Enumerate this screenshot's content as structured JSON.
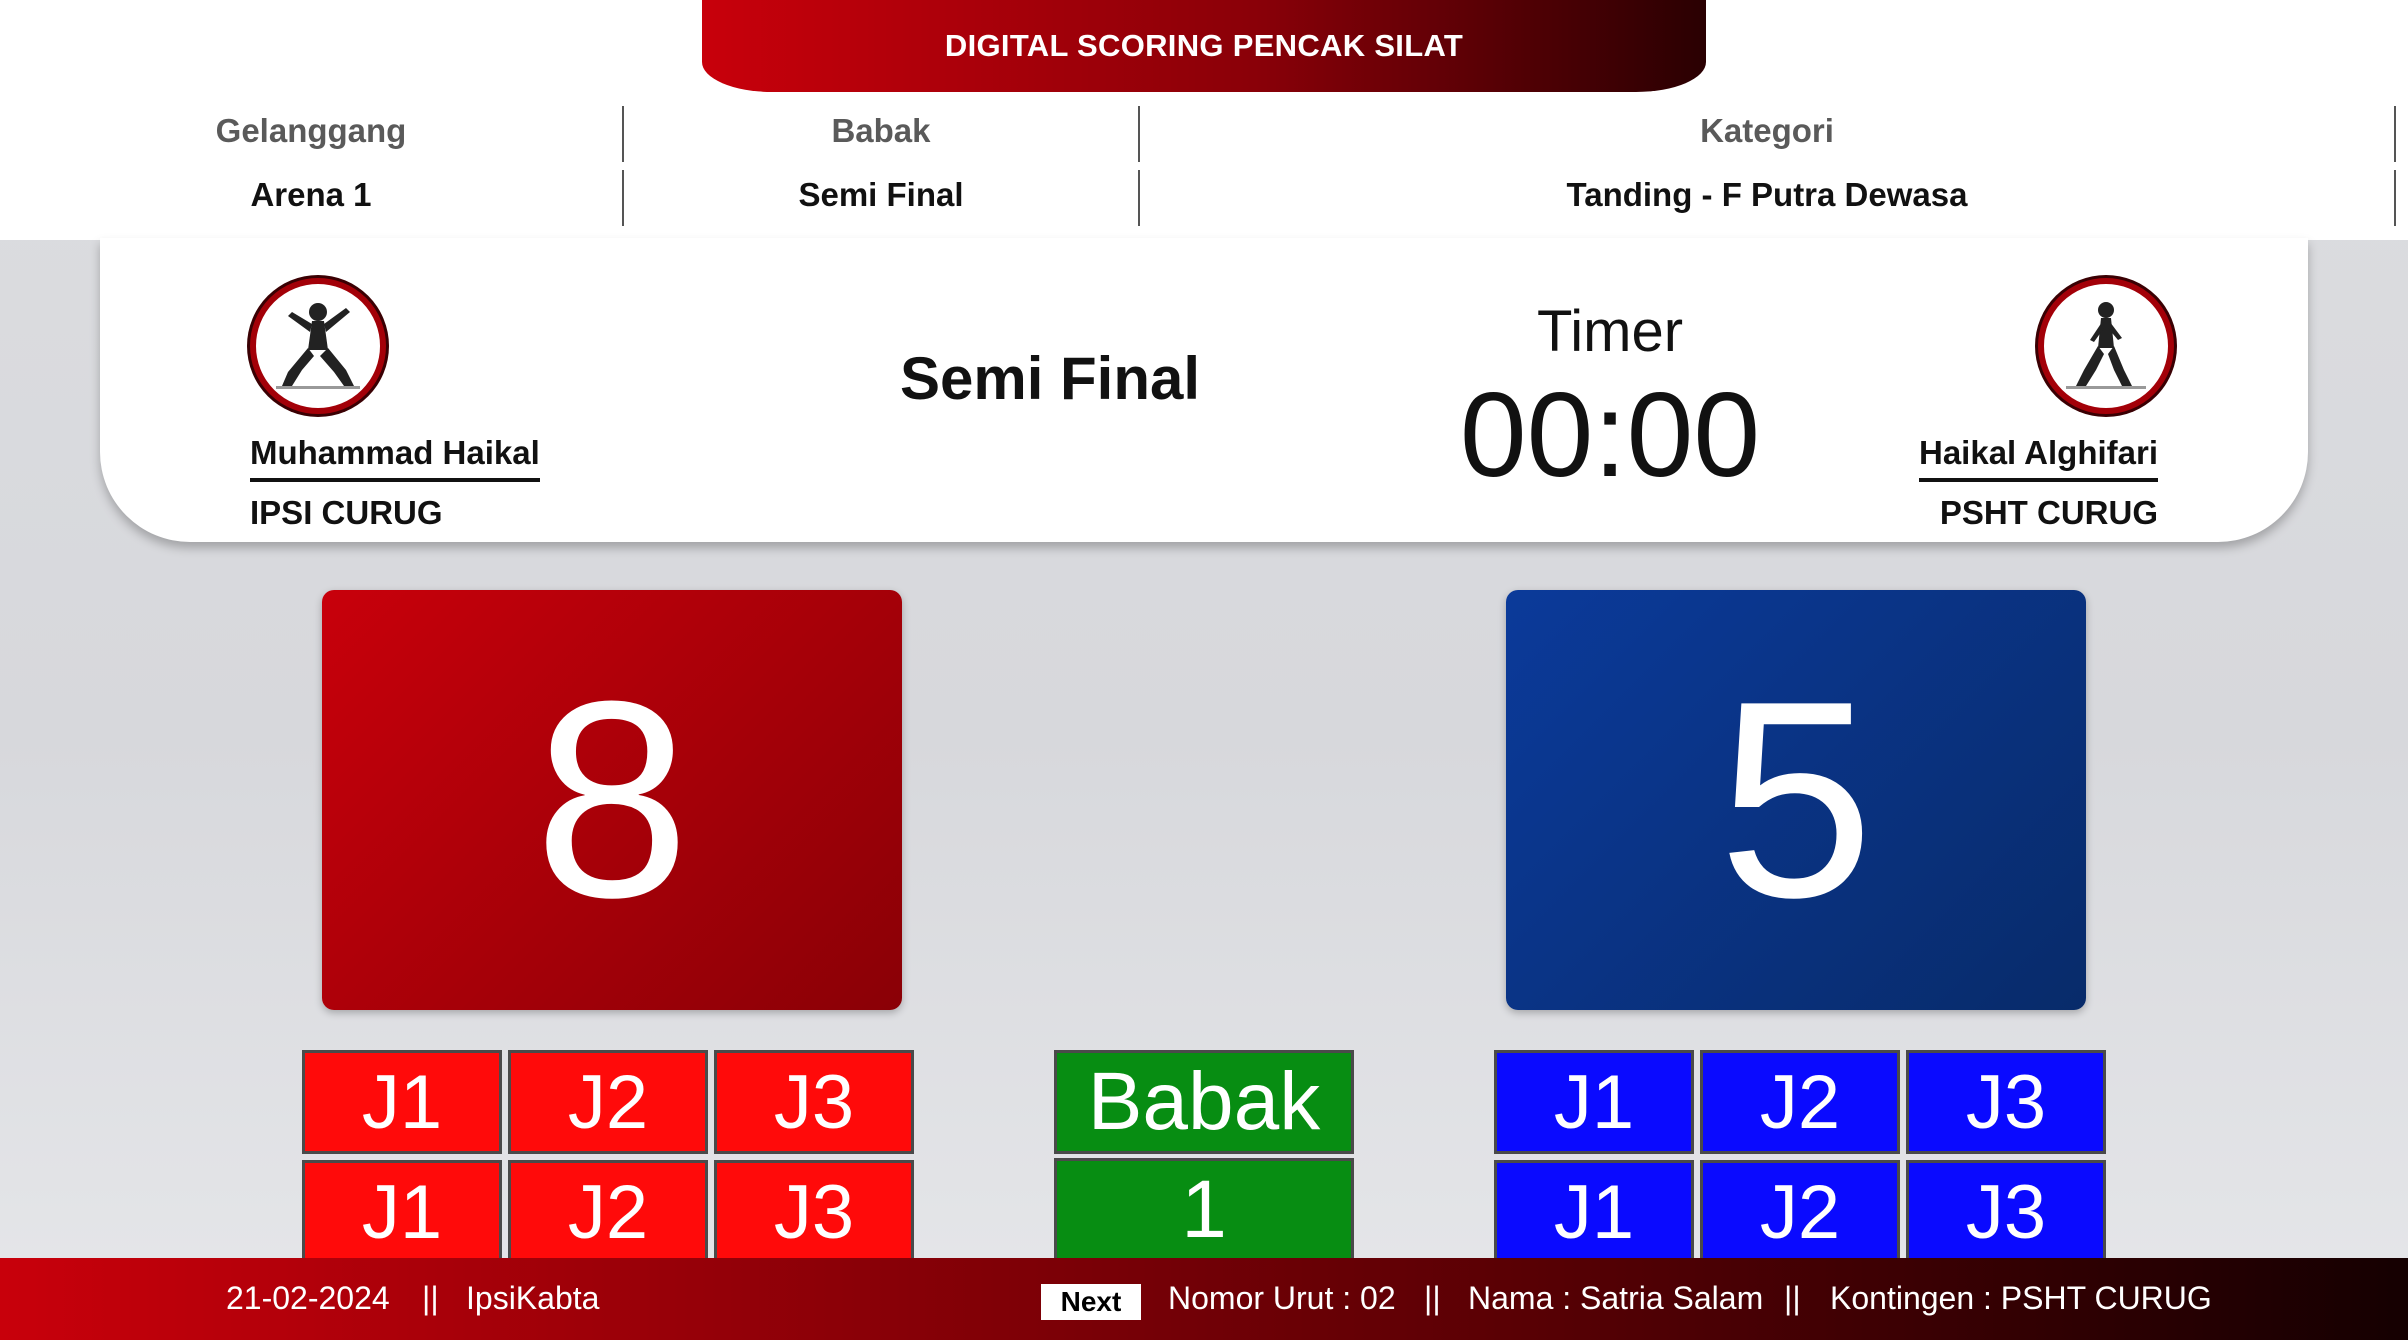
{
  "header": {
    "title": "DIGITAL SCORING PENCAK SILAT"
  },
  "info": {
    "gelanggang_label": "Gelanggang",
    "gelanggang_value": "Arena 1",
    "babak_label": "Babak",
    "babak_value": "Semi Final",
    "kategori_label": "Kategori",
    "kategori_value": "Tanding - F Putra Dewasa"
  },
  "match": {
    "round_title": "Semi Final",
    "timer_label": "Timer",
    "timer_value": "00:00",
    "red_corner": {
      "name": "Muhammad Haikal",
      "team": "IPSI CURUG",
      "score": "8",
      "color": "#c8000b"
    },
    "blue_corner": {
      "name": "Haikal Alghifari",
      "team": "PSHT CURUG",
      "score": "5",
      "color": "#0b3a9a"
    }
  },
  "judges": {
    "red": [
      "J1",
      "J2",
      "J3",
      "J1",
      "J2",
      "J3"
    ],
    "blue": [
      "J1",
      "J2",
      "J3",
      "J1",
      "J2",
      "J3"
    ]
  },
  "babak_box": {
    "label": "Babak",
    "value": "1"
  },
  "footer": {
    "date": "21-02-2024",
    "sep": "||",
    "org": "IpsiKabta",
    "next_label": "Next",
    "nomor_urut": "Nomor Urut : 02",
    "nama": "Nama : Satria Salam",
    "kontingen": "Kontingen : PSHT CURUG"
  }
}
